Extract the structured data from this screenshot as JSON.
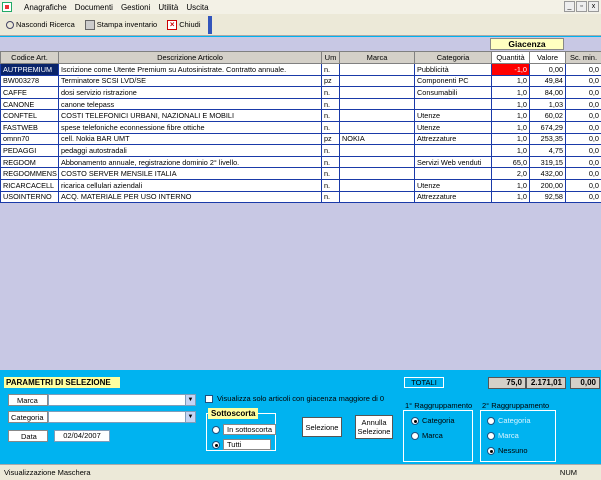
{
  "menu": [
    "Anagrafiche",
    "Documenti",
    "Gestioni",
    "Utilità",
    "Uscita"
  ],
  "toolbar": {
    "hide_search": "Nascondi Ricerca",
    "print_inventory": "Stampa inventario",
    "close": "Chiudi"
  },
  "grid": {
    "group_header": "Giacenza",
    "columns": [
      "Codice Art.",
      "Descrizione Articolo",
      "Um",
      "Marca",
      "Categoria",
      "Quantità",
      "Valore",
      "Sc. min."
    ],
    "rows": [
      [
        "AUTPREMIUM",
        "Iscrizione come Utente Premium su Autosinistrate. Contratto annuale.",
        "n.",
        "",
        "Pubblicità",
        "-1,0",
        "0,00",
        "0,0"
      ],
      [
        "BW003278",
        "Terminatore SCSI LVD/SE",
        "pz",
        "",
        "Componenti PC",
        "1,0",
        "49,84",
        "0,0"
      ],
      [
        "CAFFE",
        "dosi servizio ristrazione",
        "n.",
        "",
        "Consumabili",
        "1,0",
        "84,00",
        "0,0"
      ],
      [
        "CANONE",
        "canone telepass",
        "n.",
        "",
        "",
        "1,0",
        "1,03",
        "0,0"
      ],
      [
        "CONFTEL",
        " COSTI TELEFONICI  URBANI, NAZIONALI E MOBILI",
        "n.",
        "",
        "Utenze",
        "1,0",
        "60,02",
        "0,0"
      ],
      [
        "FASTWEB",
        "spese telefoniche econnessione  fibre ottiche",
        "n.",
        "",
        "Utenze",
        "1,0",
        "674,29",
        "0,0"
      ],
      [
        "omnn70",
        "cell. Nokia BAR UMT",
        "pz",
        "NOKIA",
        "Attrezzature",
        "1,0",
        "253,35",
        "0,0"
      ],
      [
        "PEDAGGI",
        "pedaggi autostradali",
        "n.",
        "",
        "",
        "1,0",
        "4,75",
        "0,0"
      ],
      [
        "REGDOM",
        "Abbonamento annuale, registrazione dominio 2° livello.",
        "n.",
        "",
        "Servizi Web venduti",
        "65,0",
        "319,15",
        "0,0"
      ],
      [
        "REGDOMMENS",
        "COSTO SERVER MENSILE ITALIA",
        "n.",
        "",
        "",
        "2,0",
        "432,00",
        "0,0"
      ],
      [
        "RICARCACELL",
        "ricarica cellulari aziendali",
        "n.",
        "",
        "Utenze",
        "1,0",
        "200,00",
        "0,0"
      ],
      [
        "USOINTERNO",
        "ACQ. MATERIALE PER USO INTERNO",
        "n.",
        "",
        "Attrezzature",
        "1,0",
        "92,58",
        "0,0"
      ]
    ]
  },
  "params": {
    "title": "PARAMETRI DI SELEZIONE",
    "marca_label": "Marca",
    "categoria_label": "Categoria",
    "data_label": "Data",
    "data_value": "02/04/2007",
    "only_positive_label": "Visualizza solo articoli con giacenza maggiore di 0",
    "sottoscorta_title": "Sottoscorta",
    "in_sottoscorta": "In sottoscorta",
    "tutti": "Tutti",
    "selezione_btn": "Selezione",
    "annulla_btn_l1": "Annulla",
    "annulla_btn_l2": "Selezione",
    "group1_title": "1° Raggruppamento",
    "group1_categoria": "Categoria",
    "group1_marca": "Marca",
    "group2_title": "2° Raggruppamento",
    "group2_categoria": "Categoria",
    "group2_marca": "Marca",
    "group2_nessuno": "Nessuno"
  },
  "totals": {
    "label": "TOTALI",
    "quantita": "75,0",
    "valore": "2.171,01",
    "sc_min": "0,00"
  },
  "status": {
    "text": "Visualizzazione Maschera",
    "num": "NUM"
  }
}
